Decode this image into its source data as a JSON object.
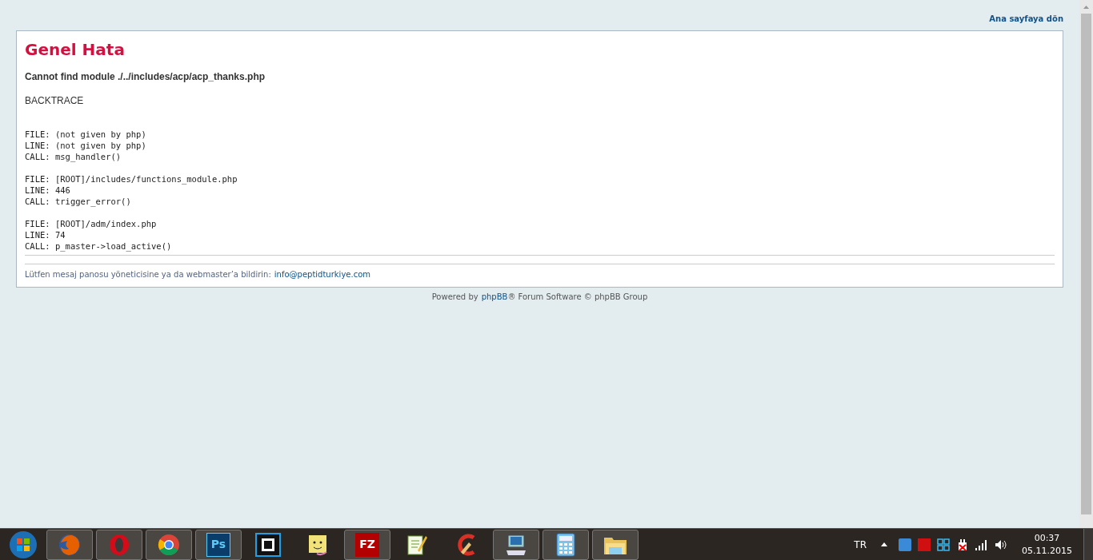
{
  "header_link": "Ana sayfaya dön",
  "error": {
    "title": "Genel Hata",
    "message": "Cannot find module ./../includes/acp/acp_thanks.php",
    "backtrace_heading": "BACKTRACE",
    "backtrace": [
      [
        "FILE: (not given by php)",
        "LINE: (not given by php)",
        "CALL: msg_handler()"
      ],
      [
        "FILE: [ROOT]/includes/functions_module.php",
        "LINE: 446",
        "CALL: trigger_error()"
      ],
      [
        "FILE: [ROOT]/adm/index.php",
        "LINE: 74",
        "CALL: p_master->load_active()"
      ]
    ],
    "contact_text": "Lütfen mesaj panosu yöneticisine ya da webmaster’a bildirin:",
    "contact_email": "info@peptidturkiye.com"
  },
  "footer": {
    "before": "Powered by",
    "link": "phpBB",
    "after": "® Forum Software © phpBB Group"
  },
  "taskbar": {
    "apps": [
      {
        "kind": "firefox",
        "open": true
      },
      {
        "kind": "opera",
        "open": true
      },
      {
        "kind": "chrome",
        "open": true
      },
      {
        "kind": "photoshop",
        "open": true,
        "label": "Ps"
      },
      {
        "kind": "film",
        "open": false
      },
      {
        "kind": "folder-face",
        "open": false
      },
      {
        "kind": "filezilla",
        "open": true,
        "label": "FZ"
      },
      {
        "kind": "notepad",
        "open": false
      },
      {
        "kind": "broom",
        "open": false
      },
      {
        "kind": "computer",
        "open": true
      },
      {
        "kind": "calculator",
        "open": true
      },
      {
        "kind": "explorer",
        "open": true
      }
    ],
    "language": "TR",
    "time": "00:37",
    "date": "05.11.2015"
  }
}
